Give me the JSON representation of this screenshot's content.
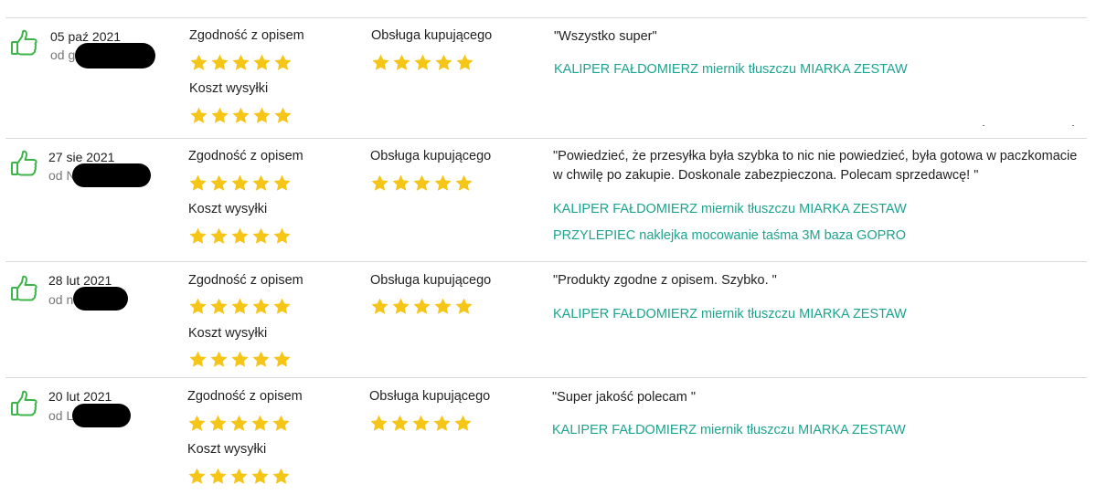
{
  "colors": {
    "star": "#f5c518",
    "link": "#1ca48e",
    "thumb": "#3bb54a",
    "divider": "#d9d9d9"
  },
  "labels": {
    "description": "Zgodność z opisem",
    "service": "Obsługa kupującego",
    "shipping": "Koszt wysyłki"
  },
  "reviews": [
    {
      "date": "05 paź 2021",
      "from": "od g",
      "rating_description": 5,
      "rating_shipping": 5,
      "rating_service": 5,
      "comment": "\"Wszystko super\"",
      "products": [
        "KALIPER FAŁDOMIERZ miernik tłuszczu MIARKA ZESTAW"
      ]
    },
    {
      "date": "27 sie 2021",
      "from": "od N",
      "rating_description": 5,
      "rating_shipping": 5,
      "rating_service": 5,
      "comment": "\"Powiedzieć, że przesyłka była szybka to nic nie powiedzieć, była gotowa w paczkomacie w chwilę po zakupie. Doskonale zabezpieczona. Polecam sprzedawcę! \"",
      "products": [
        "KALIPER FAŁDOMIERZ miernik tłuszczu MIARKA ZESTAW",
        "PRZYLEPIEC naklejka mocowanie taśma 3M baza GOPRO"
      ]
    },
    {
      "date": "28 lut 2021",
      "from": "od n",
      "rating_description": 5,
      "rating_shipping": 5,
      "rating_service": 5,
      "comment": "\"Produkty zgodne z opisem. Szybko. \"",
      "products": [
        "KALIPER FAŁDOMIERZ miernik tłuszczu MIARKA ZESTAW"
      ]
    },
    {
      "date": "20 lut 2021",
      "from": "od L",
      "rating_description": 5,
      "rating_shipping": 5,
      "rating_service": 5,
      "comment": "\"Super jakość polecam \"",
      "products": [
        "KALIPER FAŁDOMIERZ miernik tłuszczu MIARKA ZESTAW"
      ]
    }
  ]
}
